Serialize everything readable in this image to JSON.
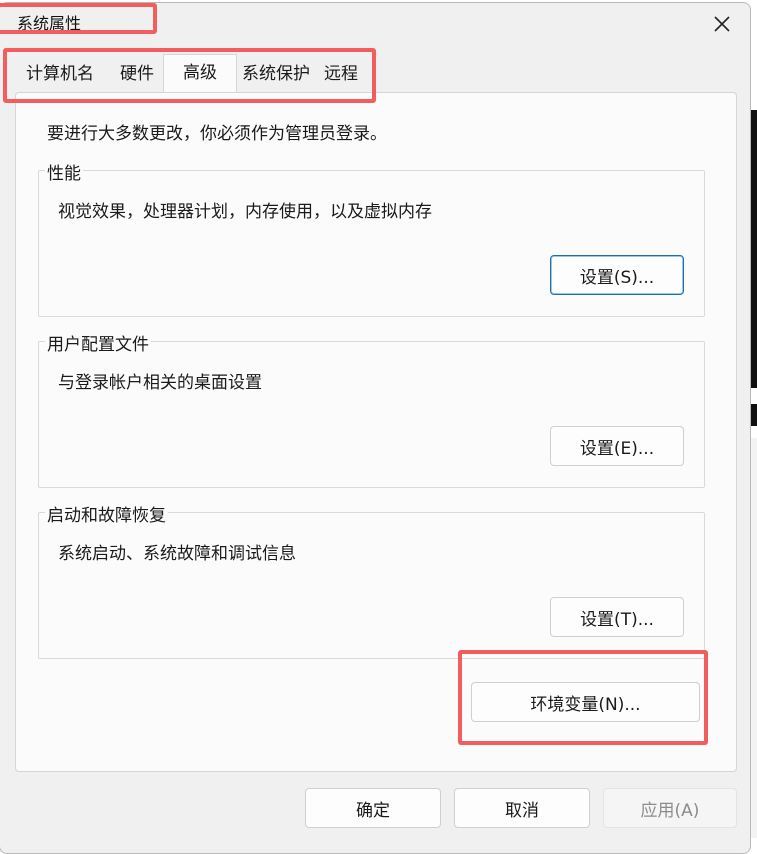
{
  "window": {
    "title": "系统属性"
  },
  "tabs": [
    {
      "label": "计算机名"
    },
    {
      "label": "硬件"
    },
    {
      "label": "高级",
      "active": true
    },
    {
      "label": "系统保护"
    },
    {
      "label": "远程"
    }
  ],
  "notice": "要进行大多数更改，你必须作为管理员登录。",
  "groups": {
    "performance": {
      "title": "性能",
      "desc": "视觉效果，处理器计划，内存使用，以及虚拟内存",
      "button": "设置(S)..."
    },
    "profiles": {
      "title": "用户配置文件",
      "desc": "与登录帐户相关的桌面设置",
      "button": "设置(E)..."
    },
    "startup": {
      "title": "启动和故障恢复",
      "desc": "系统启动、系统故障和调试信息",
      "button": "设置(T)..."
    }
  },
  "env_button": "环境变量(N)...",
  "footer": {
    "ok": "确定",
    "cancel": "取消",
    "apply": "应用(A)"
  },
  "colors": {
    "highlight": "#f25d5d",
    "focus_border": "#1f6fae"
  }
}
